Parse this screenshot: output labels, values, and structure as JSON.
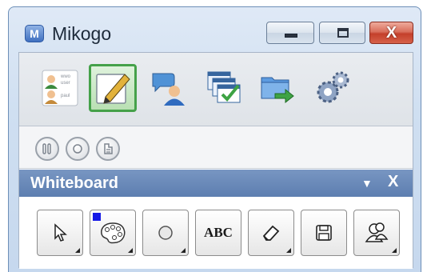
{
  "window": {
    "title": "Mikogo",
    "app_icon_letter": "M",
    "controls": {
      "minimize_icon": "minimize-icon",
      "maximize_icon": "maximize-icon",
      "close_label": "X"
    }
  },
  "toolbar": {
    "buttons": [
      {
        "name": "participants",
        "icon": "participants-icon",
        "label_lines": [
          "wwo",
          "user",
          "paul"
        ]
      },
      {
        "name": "whiteboard",
        "icon": "pencil-edit-icon",
        "active": true
      },
      {
        "name": "chat",
        "icon": "chat-icon"
      },
      {
        "name": "application-selection",
        "icon": "window-check-icon"
      },
      {
        "name": "file-transfer",
        "icon": "folder-transfer-icon"
      },
      {
        "name": "settings",
        "icon": "gears-icon"
      }
    ]
  },
  "session_controls": [
    {
      "name": "pause",
      "icon": "pause-icon"
    },
    {
      "name": "record",
      "icon": "record-icon"
    },
    {
      "name": "presenter",
      "icon": "switch-presenter-icon"
    }
  ],
  "whiteboard": {
    "title": "Whiteboard",
    "collapse_icon": "chevron-down-icon",
    "close_label": "X",
    "tools": [
      {
        "name": "pointer",
        "icon": "cursor-icon"
      },
      {
        "name": "color",
        "icon": "palette-icon",
        "selected_color": "#1418e6"
      },
      {
        "name": "shape",
        "icon": "circle-icon"
      },
      {
        "name": "text",
        "label": "ABC"
      },
      {
        "name": "eraser",
        "icon": "eraser-icon"
      },
      {
        "name": "save",
        "icon": "save-icon"
      },
      {
        "name": "users",
        "icon": "users-icon"
      }
    ]
  },
  "colors": {
    "accent_green": "#45a14a",
    "header_blue": "#5d7eb0",
    "close_red": "#c4402b"
  }
}
